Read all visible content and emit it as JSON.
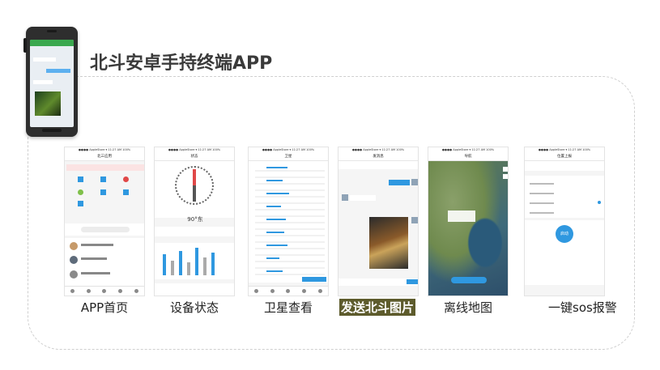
{
  "title": "北斗安卓手持终端APP",
  "cards": [
    {
      "label": "APP首页",
      "header": "北三应用"
    },
    {
      "label": "设备状态",
      "header": "状态",
      "compass": "90°东"
    },
    {
      "label": "卫星查看",
      "header": "卫星"
    },
    {
      "label": "发送北斗图片",
      "header": "发消息"
    },
    {
      "label": "离线地图",
      "header": "导航"
    },
    {
      "label": "一键sos报警",
      "header": "位置上报",
      "button": "启动"
    }
  ],
  "colors": {
    "accent": "#2f98e0",
    "highlight": "#5d5b2c",
    "sos_red": "#e04848"
  }
}
